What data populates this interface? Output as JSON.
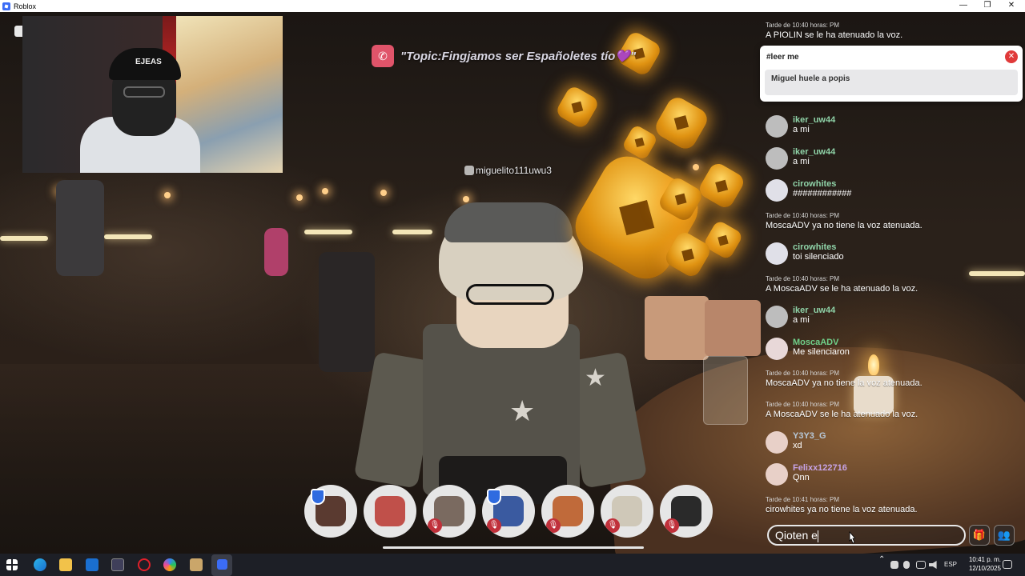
{
  "window": {
    "title": "Roblox",
    "minimize": "—",
    "restore": "❐",
    "close": "✕"
  },
  "topic": "\"Topic:Fingjamos ser Españoletes tío💜\"",
  "nametag": "miguelito111uwu3",
  "webcam": {
    "cap_text": "EJEAS"
  },
  "pinned": {
    "title": "#leer me",
    "body": "Miguel huele a popis"
  },
  "chat": {
    "top_time": "Tarde de 10:40 horas: PM",
    "top_msg": "A PIOLIN se le ha atenuado la voz.",
    "messages": [
      {
        "kind": "user",
        "user": "iker_uw44",
        "color": "#8fd3a8",
        "text": "a mi"
      },
      {
        "kind": "user",
        "user": "iker_uw44",
        "color": "#8fd3a8",
        "text": "a mi"
      },
      {
        "kind": "user",
        "user": "cirowhites",
        "color": "#8fd3a8",
        "text": "############"
      },
      {
        "kind": "system",
        "time": "Tarde de 10:40 horas: PM",
        "text": "MoscaADV ya no tiene la voz atenuada."
      },
      {
        "kind": "user",
        "user": "cirowhites",
        "color": "#8fd3a8",
        "text": "toi silenciado"
      },
      {
        "kind": "system",
        "time": "Tarde de 10:40 horas: PM",
        "text": "A MoscaADV se le ha atenuado la voz."
      },
      {
        "kind": "user",
        "user": "iker_uw44",
        "color": "#8fd3a8",
        "text": "a mi"
      },
      {
        "kind": "user",
        "user": "MoscaADV",
        "color": "#6fd08a",
        "text": "Me silenciaron"
      },
      {
        "kind": "system",
        "time": "Tarde de 10:40 horas: PM",
        "text": "MoscaADV ya no tiene la voz atenuada."
      },
      {
        "kind": "system",
        "time": "Tarde de 10:40 horas: PM",
        "text": "A MoscaADV se le ha atenuado la voz."
      },
      {
        "kind": "user",
        "user": "Y3Y3_G",
        "color": "#b7c8d8",
        "text": "xd"
      },
      {
        "kind": "user",
        "user": "Felixx122716",
        "color": "#c7a3e6",
        "text": "Qnn"
      },
      {
        "kind": "system",
        "time": "Tarde de 10:41 horas: PM",
        "text": "cirowhites ya no tiene la voz atenuada."
      }
    ]
  },
  "chat_input": {
    "value": "Qioten e"
  },
  "buttons": {
    "gift": "🎁",
    "people": "👥"
  },
  "taskbar": {
    "lang": "ESP",
    "time": "10:41 p. m.",
    "date": "12/10/2025",
    "tray_up": "⌃"
  },
  "colors": {
    "accent_red": "#e03a3a",
    "robux_gold": "#e09312",
    "mic_muted": "#c0303a"
  }
}
